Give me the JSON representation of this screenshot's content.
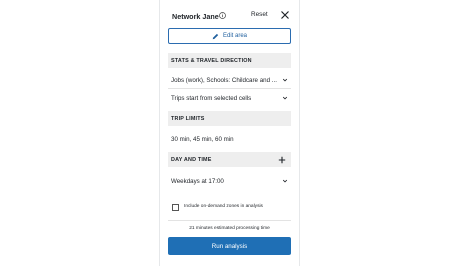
{
  "panel": {
    "title": "Network Jane",
    "reset_label": "Reset",
    "edit_area_label": "Edit area"
  },
  "stats": {
    "heading": "STATS & TRAVEL DIRECTION",
    "destinations_value": "Jobs (work), Schools: Childcare and ...",
    "direction_value": "Trips start from selected cells"
  },
  "trip_limits": {
    "heading": "TRIP LIMITS",
    "value": "30 min, 45 min, 60 min"
  },
  "day_time": {
    "heading": "DAY AND TIME",
    "value": "Weekdays at 17:00"
  },
  "options": {
    "ondemand_label": "Include on-demand zones in analysis",
    "ondemand_checked": false
  },
  "footer": {
    "estimate_text": "21 minutes estimated processing time",
    "run_label": "Run analysis"
  },
  "colors": {
    "accent": "#1f6fb5",
    "section_bg": "#eeeeee"
  }
}
